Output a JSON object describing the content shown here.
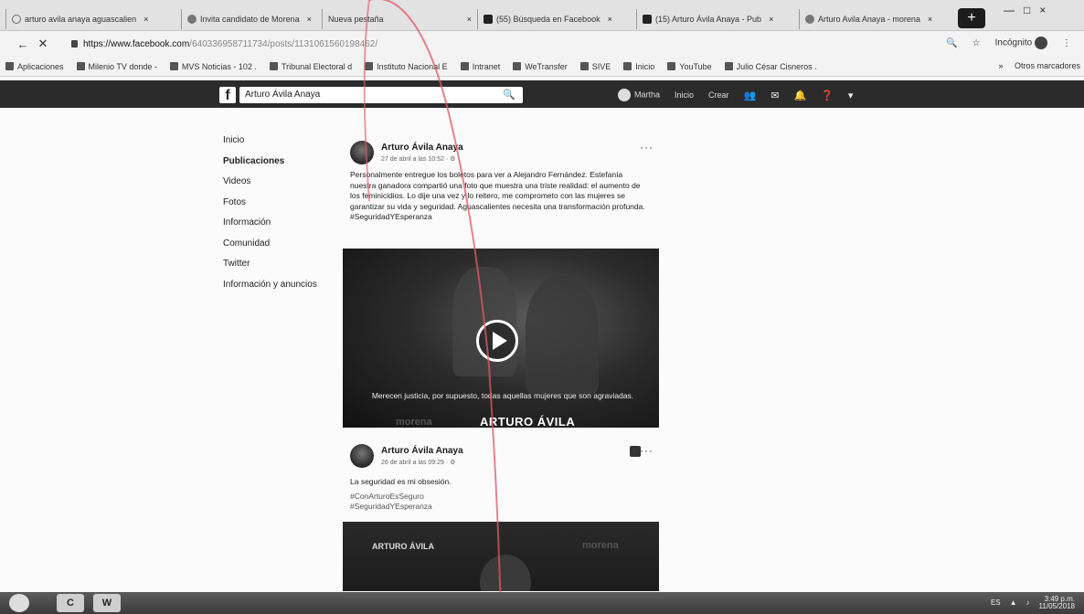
{
  "browser": {
    "tabs": [
      {
        "label": "arturo avila anaya aguascalien",
        "favicon": "google-icon"
      },
      {
        "label": "Invita candidato de Morena",
        "favicon": "page-icon"
      },
      {
        "label": "Nueva pestaña",
        "favicon": "none"
      },
      {
        "label": "(55) Búsqueda en Facebook",
        "favicon": "facebook-icon"
      },
      {
        "label": "(15) Arturo Ávila Anaya - Pub",
        "favicon": "facebook-icon"
      },
      {
        "label": "Arturo Avila Anaya - morena",
        "favicon": "page-icon"
      }
    ],
    "close_glyph": "×",
    "new_tab_glyph": "+",
    "window_controls": [
      "—",
      "□",
      "×"
    ],
    "nav": {
      "back": "←",
      "stop": "✕"
    },
    "url_domain": "https://www.facebook.com",
    "url_path": "/640336958711734/posts/1131061560198462/",
    "zoom_icon": "🔍",
    "star_icon": "☆",
    "incognito_label": "Incógnito",
    "menu_icon": "⋮",
    "bookmarks": [
      {
        "label": "Aplicaciones"
      },
      {
        "label": "Milenio TV donde -"
      },
      {
        "label": "MVS Noticias - 102 ."
      },
      {
        "label": "Tribunal Electoral d"
      },
      {
        "label": "Instituto Nacional E"
      },
      {
        "label": "Intranet"
      },
      {
        "label": "WeTransfer"
      },
      {
        "label": "SIVE"
      },
      {
        "label": "Inicio"
      },
      {
        "label": "YouTube"
      },
      {
        "label": "Julio César Cisneros ."
      }
    ],
    "bookmarks_more": "»",
    "other_bookmarks": "Otros marcadores"
  },
  "facebook": {
    "logo": "f",
    "search_value": "Arturo Ávila Anaya",
    "search_icon": "🔍",
    "nav": {
      "user": "Martha",
      "home": "Inicio",
      "create": "Crear"
    },
    "nav_icons": [
      "friends-icon",
      "messenger-icon",
      "notifications-icon",
      "help-icon",
      "menu-icon"
    ]
  },
  "left_menu": [
    {
      "label": "Inicio",
      "active": false
    },
    {
      "label": "Publicaciones",
      "active": true
    },
    {
      "label": "Videos",
      "active": false
    },
    {
      "label": "Fotos",
      "active": false
    },
    {
      "label": "Información",
      "active": false
    },
    {
      "label": "Comunidad",
      "active": false
    },
    {
      "label": "Twitter",
      "active": false
    },
    {
      "label": "Información y anuncios",
      "active": false
    }
  ],
  "posts": [
    {
      "author": "Arturo Ávila Anaya",
      "date": "27 de abril a las 10:52 · ⚙",
      "more": "···",
      "text": "Personalmente entregue los boletos para ver a Alejandro Fernández. Estefanía nuestra ganadora compartió una foto que muestra una triste realidad: el aumento de los feminicidios. Lo dije una vez y lo reitero, me comprometo con las mujeres se garantizar su vida y seguridad. Aguascalientes necesita una transformación profunda. #SeguridadYEsperanza",
      "video_caption": "Merecen justicia, por supuesto, todas aquellas mujeres que son agraviadas.",
      "video_brand": "ARTURO ÁVILA",
      "video_brand_secondary": "morena"
    },
    {
      "author": "Arturo Ávila Anaya",
      "date": "26 de abril a las 09:29 · ⚙",
      "more": "···",
      "text": "La seguridad es mi obsesión.",
      "hashtag1": "#ConArturoEsSeguro",
      "hashtag2": "#SeguridadYEsperanza",
      "image_brand": "ARTURO ÁVILA",
      "image_brand_secondary": "morena"
    }
  ],
  "taskbar": {
    "apps": [
      "C",
      "W"
    ],
    "lang": "ES",
    "time": "3:49 p.m.",
    "date": "11/05/2018"
  },
  "colors": {
    "fb_header": "#2b2b2b",
    "page_bg": "#fbfbfb",
    "red_line": "#e05a6a"
  }
}
